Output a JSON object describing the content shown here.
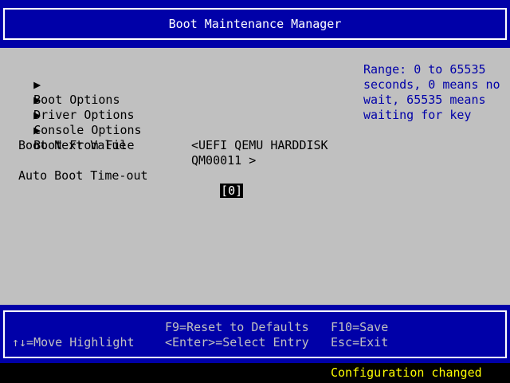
{
  "header": {
    "title": "Boot Maintenance Manager"
  },
  "menu": {
    "items": [
      {
        "label": "Boot Options"
      },
      {
        "label": "Driver Options"
      },
      {
        "label": "Console Options"
      },
      {
        "label": "Boot From File"
      }
    ]
  },
  "fields": {
    "boot_next": {
      "label": "Boot Next Value",
      "value_line1": "<UEFI QEMU HARDDISK",
      "value_line2": "QM00011 >"
    },
    "auto_boot": {
      "label": "Auto Boot Time-out",
      "value": "[0]"
    }
  },
  "help": {
    "lines": [
      "Range: 0 to 65535",
      "seconds, 0 means no",
      "wait, 65535 means",
      "waiting for key"
    ]
  },
  "footer": {
    "move_highlight": "↑↓=Move Highlight",
    "reset_defaults": "F9=Reset to Defaults",
    "select_entry": "<Enter>=Select Entry",
    "save": "F10=Save",
    "exit": "Esc=Exit"
  },
  "status": {
    "text": "Configuration changed"
  },
  "icons": {
    "menu_arrow": "right-triangle-icon"
  },
  "colors": {
    "header_bg": "#0000a8",
    "body_bg": "#c0c0c0",
    "help_text": "#0000a8",
    "status_text": "#ffff00"
  }
}
